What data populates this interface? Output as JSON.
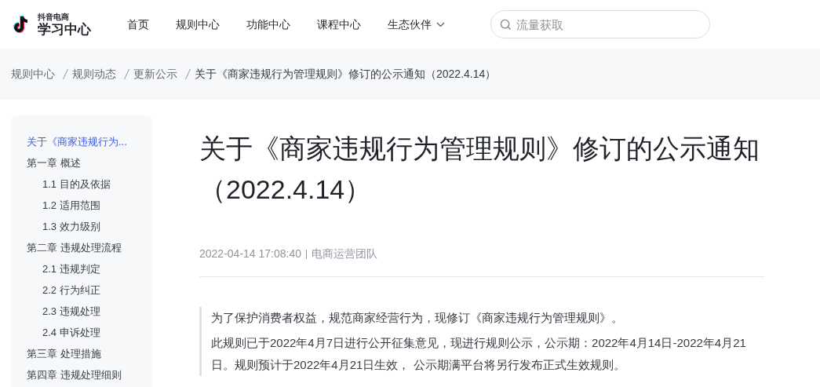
{
  "header": {
    "logo": {
      "small": "抖音电商",
      "large": "学习中心"
    },
    "nav": [
      {
        "label": "首页",
        "dropdown": false
      },
      {
        "label": "规则中心",
        "dropdown": false
      },
      {
        "label": "功能中心",
        "dropdown": false
      },
      {
        "label": "课程中心",
        "dropdown": false
      },
      {
        "label": "生态伙伴",
        "dropdown": true
      }
    ],
    "search": {
      "placeholder": "流量获取"
    }
  },
  "breadcrumb": [
    "规则中心",
    "规则动态",
    "更新公示",
    "关于《商家违规行为管理规则》修订的公示通知（2022.4.14）"
  ],
  "toc": [
    {
      "label": "关于《商家违规行为...",
      "selected": true
    },
    {
      "label": "第一章 概述",
      "selected": false,
      "children": [
        {
          "label": "1.1 目的及依据",
          "selected": false
        },
        {
          "label": "1.2 适用范围",
          "selected": false
        },
        {
          "label": "1.3 效力级别",
          "selected": false
        }
      ]
    },
    {
      "label": "第二章 违规处理流程",
      "selected": false,
      "children": [
        {
          "label": "2.1 违规判定",
          "selected": false
        },
        {
          "label": "2.2 行为纠正",
          "selected": false
        },
        {
          "label": "2.3 违规处理",
          "selected": false
        },
        {
          "label": "2.4 申诉处理",
          "selected": false
        }
      ]
    },
    {
      "label": "第三章 处理措施",
      "selected": false
    },
    {
      "label": "第四章 违规处理细则",
      "selected": false
    }
  ],
  "article": {
    "title": "关于《商家违规行为管理规则》修订的公示通知（2022.4.14）",
    "time": "2022-04-14 17:08:40",
    "author": "电商运营团队",
    "notice": [
      "为了保护消费者权益，规范商家经营行为，现修订《商家违规行为管理规则》。",
      "此规则已于2022年4月7日进行公开征集意见，现进行规则公示，公示期：2022年4月14日-2022年4月21日。规则预计于2022年4月21日生效， 公示期满平台将另行发布正式生效规则。"
    ]
  }
}
